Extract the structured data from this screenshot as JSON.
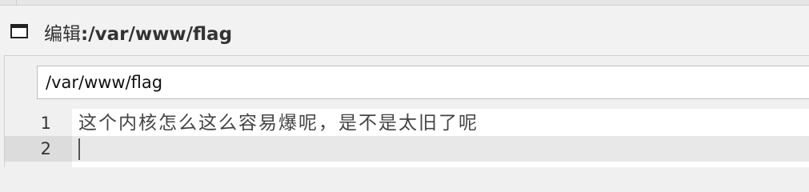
{
  "header": {
    "label": "编辑",
    "separator": ": ",
    "path": "/var/www/flag"
  },
  "path_input": {
    "value": "/var/www/flag"
  },
  "editor": {
    "lines": [
      {
        "number": "1",
        "text": "这个内核怎么这么容易爆呢，是不是太旧了呢"
      },
      {
        "number": "2",
        "text": ""
      }
    ]
  }
}
